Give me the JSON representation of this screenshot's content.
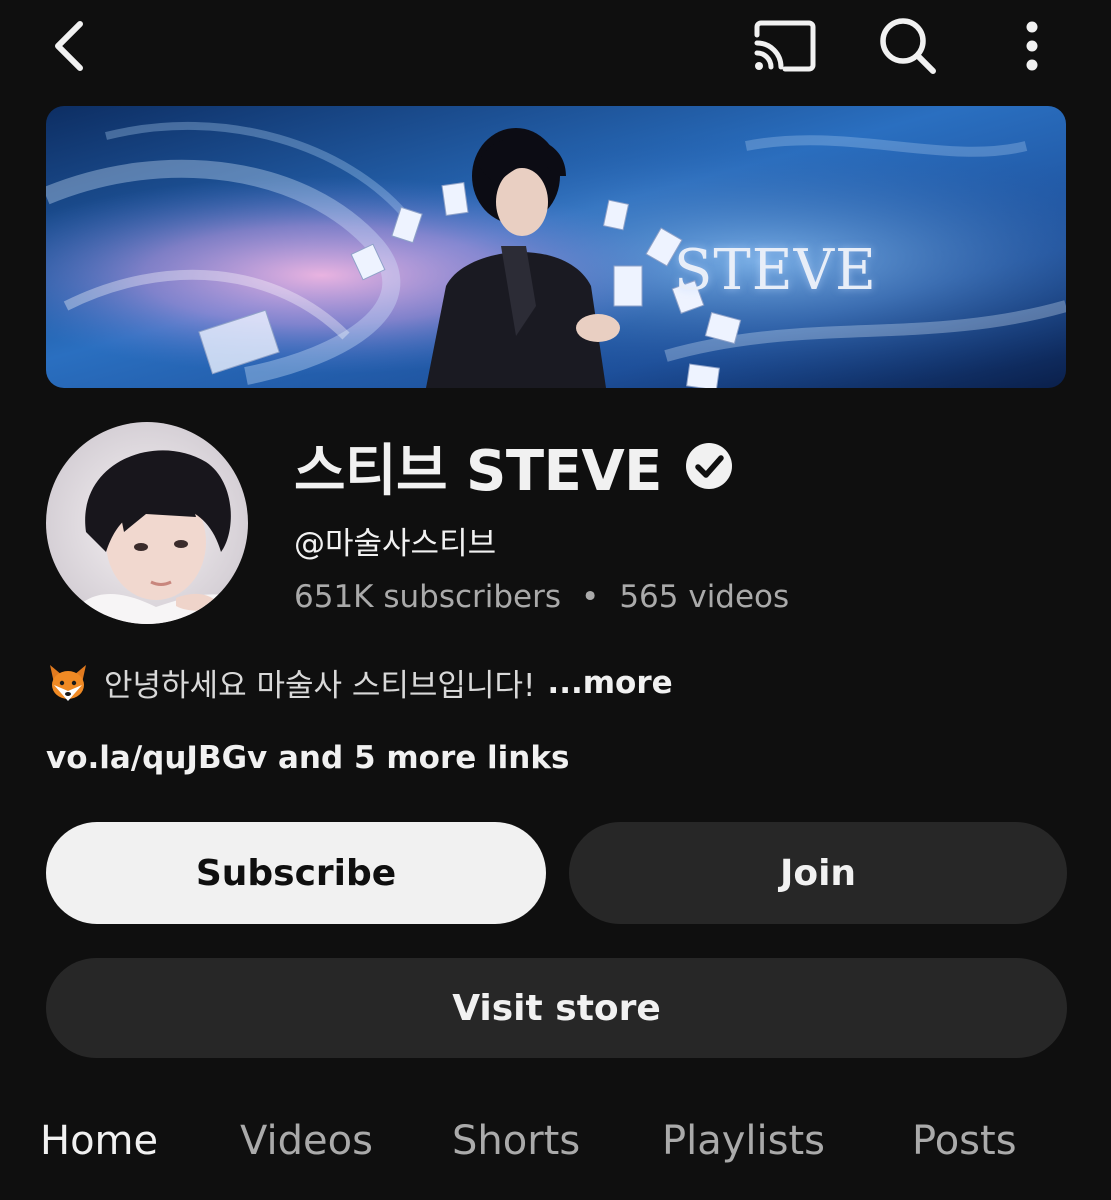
{
  "toolbar": {
    "back_icon": "back-arrow-icon",
    "cast_icon": "cast-icon",
    "search_icon": "search-icon",
    "more_icon": "more-vertical-icon"
  },
  "banner": {
    "wordmark": "STEVE"
  },
  "channel": {
    "name": "스티브 STEVE",
    "verified": true,
    "handle": "@마술사스티브",
    "subscribers": "651K subscribers",
    "separator": "•",
    "videos": "565 videos",
    "description": "안녕하세요 마술사 스티브입니다!",
    "description_more": "...more",
    "links": "vo.la/quJBGv and 5 more links"
  },
  "actions": {
    "subscribe": "Subscribe",
    "join": "Join",
    "visit_store": "Visit store"
  },
  "tabs": [
    {
      "label": "Home",
      "active": true
    },
    {
      "label": "Videos",
      "active": false
    },
    {
      "label": "Shorts",
      "active": false
    },
    {
      "label": "Playlists",
      "active": false
    },
    {
      "label": "Posts",
      "active": false
    }
  ],
  "colors": {
    "background": "#0f0f0f",
    "primary_text": "#f1f1f1",
    "secondary_text": "#aaaaaa",
    "button_dark": "#272727",
    "button_light": "#f1f1f1"
  }
}
